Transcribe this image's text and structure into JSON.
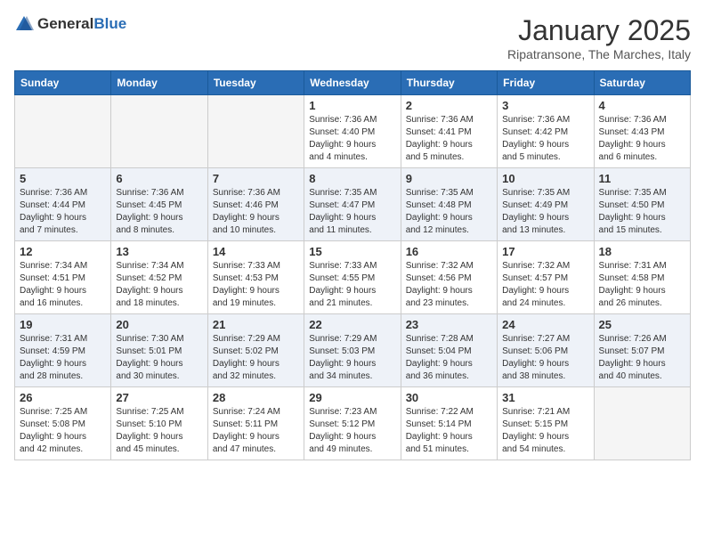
{
  "logo": {
    "general": "General",
    "blue": "Blue"
  },
  "header": {
    "title": "January 2025",
    "subtitle": "Ripatransone, The Marches, Italy"
  },
  "days_of_week": [
    "Sunday",
    "Monday",
    "Tuesday",
    "Wednesday",
    "Thursday",
    "Friday",
    "Saturday"
  ],
  "weeks": [
    [
      {
        "day": "",
        "info": ""
      },
      {
        "day": "",
        "info": ""
      },
      {
        "day": "",
        "info": ""
      },
      {
        "day": "1",
        "info": "Sunrise: 7:36 AM\nSunset: 4:40 PM\nDaylight: 9 hours\nand 4 minutes."
      },
      {
        "day": "2",
        "info": "Sunrise: 7:36 AM\nSunset: 4:41 PM\nDaylight: 9 hours\nand 5 minutes."
      },
      {
        "day": "3",
        "info": "Sunrise: 7:36 AM\nSunset: 4:42 PM\nDaylight: 9 hours\nand 5 minutes."
      },
      {
        "day": "4",
        "info": "Sunrise: 7:36 AM\nSunset: 4:43 PM\nDaylight: 9 hours\nand 6 minutes."
      }
    ],
    [
      {
        "day": "5",
        "info": "Sunrise: 7:36 AM\nSunset: 4:44 PM\nDaylight: 9 hours\nand 7 minutes."
      },
      {
        "day": "6",
        "info": "Sunrise: 7:36 AM\nSunset: 4:45 PM\nDaylight: 9 hours\nand 8 minutes."
      },
      {
        "day": "7",
        "info": "Sunrise: 7:36 AM\nSunset: 4:46 PM\nDaylight: 9 hours\nand 10 minutes."
      },
      {
        "day": "8",
        "info": "Sunrise: 7:35 AM\nSunset: 4:47 PM\nDaylight: 9 hours\nand 11 minutes."
      },
      {
        "day": "9",
        "info": "Sunrise: 7:35 AM\nSunset: 4:48 PM\nDaylight: 9 hours\nand 12 minutes."
      },
      {
        "day": "10",
        "info": "Sunrise: 7:35 AM\nSunset: 4:49 PM\nDaylight: 9 hours\nand 13 minutes."
      },
      {
        "day": "11",
        "info": "Sunrise: 7:35 AM\nSunset: 4:50 PM\nDaylight: 9 hours\nand 15 minutes."
      }
    ],
    [
      {
        "day": "12",
        "info": "Sunrise: 7:34 AM\nSunset: 4:51 PM\nDaylight: 9 hours\nand 16 minutes."
      },
      {
        "day": "13",
        "info": "Sunrise: 7:34 AM\nSunset: 4:52 PM\nDaylight: 9 hours\nand 18 minutes."
      },
      {
        "day": "14",
        "info": "Sunrise: 7:33 AM\nSunset: 4:53 PM\nDaylight: 9 hours\nand 19 minutes."
      },
      {
        "day": "15",
        "info": "Sunrise: 7:33 AM\nSunset: 4:55 PM\nDaylight: 9 hours\nand 21 minutes."
      },
      {
        "day": "16",
        "info": "Sunrise: 7:32 AM\nSunset: 4:56 PM\nDaylight: 9 hours\nand 23 minutes."
      },
      {
        "day": "17",
        "info": "Sunrise: 7:32 AM\nSunset: 4:57 PM\nDaylight: 9 hours\nand 24 minutes."
      },
      {
        "day": "18",
        "info": "Sunrise: 7:31 AM\nSunset: 4:58 PM\nDaylight: 9 hours\nand 26 minutes."
      }
    ],
    [
      {
        "day": "19",
        "info": "Sunrise: 7:31 AM\nSunset: 4:59 PM\nDaylight: 9 hours\nand 28 minutes."
      },
      {
        "day": "20",
        "info": "Sunrise: 7:30 AM\nSunset: 5:01 PM\nDaylight: 9 hours\nand 30 minutes."
      },
      {
        "day": "21",
        "info": "Sunrise: 7:29 AM\nSunset: 5:02 PM\nDaylight: 9 hours\nand 32 minutes."
      },
      {
        "day": "22",
        "info": "Sunrise: 7:29 AM\nSunset: 5:03 PM\nDaylight: 9 hours\nand 34 minutes."
      },
      {
        "day": "23",
        "info": "Sunrise: 7:28 AM\nSunset: 5:04 PM\nDaylight: 9 hours\nand 36 minutes."
      },
      {
        "day": "24",
        "info": "Sunrise: 7:27 AM\nSunset: 5:06 PM\nDaylight: 9 hours\nand 38 minutes."
      },
      {
        "day": "25",
        "info": "Sunrise: 7:26 AM\nSunset: 5:07 PM\nDaylight: 9 hours\nand 40 minutes."
      }
    ],
    [
      {
        "day": "26",
        "info": "Sunrise: 7:25 AM\nSunset: 5:08 PM\nDaylight: 9 hours\nand 42 minutes."
      },
      {
        "day": "27",
        "info": "Sunrise: 7:25 AM\nSunset: 5:10 PM\nDaylight: 9 hours\nand 45 minutes."
      },
      {
        "day": "28",
        "info": "Sunrise: 7:24 AM\nSunset: 5:11 PM\nDaylight: 9 hours\nand 47 minutes."
      },
      {
        "day": "29",
        "info": "Sunrise: 7:23 AM\nSunset: 5:12 PM\nDaylight: 9 hours\nand 49 minutes."
      },
      {
        "day": "30",
        "info": "Sunrise: 7:22 AM\nSunset: 5:14 PM\nDaylight: 9 hours\nand 51 minutes."
      },
      {
        "day": "31",
        "info": "Sunrise: 7:21 AM\nSunset: 5:15 PM\nDaylight: 9 hours\nand 54 minutes."
      },
      {
        "day": "",
        "info": ""
      }
    ]
  ]
}
